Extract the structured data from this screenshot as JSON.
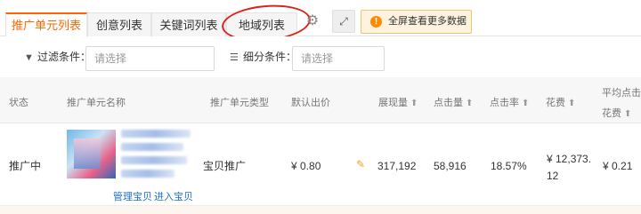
{
  "tabs": [
    {
      "label": "推广单元列表",
      "active": true
    },
    {
      "label": "创意列表",
      "active": false
    },
    {
      "label": "关键词列表",
      "active": false
    },
    {
      "label": "地域列表",
      "active": false
    }
  ],
  "toolbar": {
    "gear_icon": "gear-icon",
    "expand_icon": "expand-icon",
    "fullscreen_label": "全屏查看更多数据",
    "warn_glyph": "!"
  },
  "filters": {
    "filter_label": "过滤条件：",
    "filter_placeholder": "请选择",
    "segment_label": "细分条件：",
    "segment_placeholder": "请选择"
  },
  "table": {
    "headers": {
      "status": "状态",
      "unit_name": "推广单元名称",
      "unit_type": "推广单元类型",
      "default_bid": "默认出价",
      "impressions": "展现量",
      "clicks": "点击量",
      "ctr": "点击率",
      "cost": "花费",
      "avg_cpc_line1": "平均点击",
      "avg_cpc_line2": "花费"
    },
    "sort_arrow": "⬆",
    "row": {
      "status": "推广中",
      "manage_link": "管理宝贝",
      "enter_link": "进入宝贝",
      "unit_type": "宝贝推广",
      "default_bid": "¥ 0.80",
      "impressions": "317,192",
      "clicks": "58,916",
      "ctr": "18.57%",
      "cost_line1": "¥ 12,373.",
      "cost_line2": "12",
      "avg_cpc": "¥ 0.21"
    }
  },
  "colors": {
    "accent": "#ff6600",
    "link": "#1e6fc2",
    "annotation": "#d9241b"
  }
}
